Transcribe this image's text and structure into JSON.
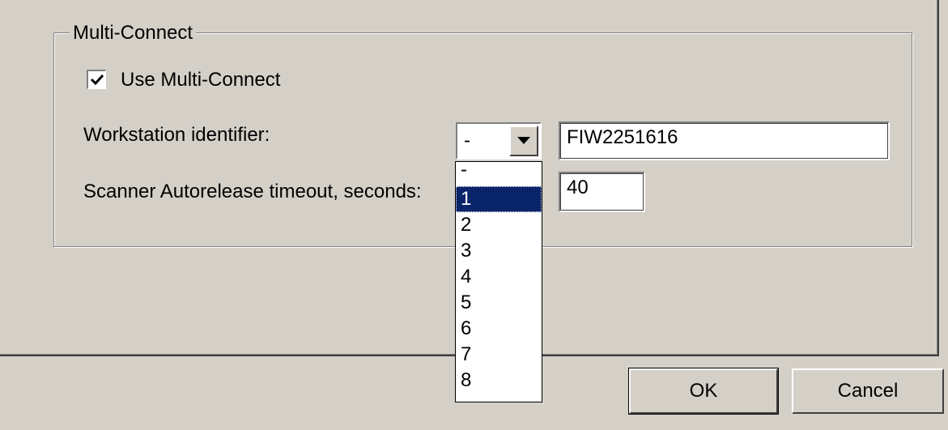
{
  "group": {
    "title": "Multi-Connect"
  },
  "use_multi_connect": {
    "label": "Use Multi-Connect",
    "checked": true
  },
  "workstation": {
    "label": "Workstation identifier:",
    "combo_value": "-",
    "dropdown_options": [
      "-",
      "1",
      "2",
      "3",
      "4",
      "5",
      "6",
      "7",
      "8"
    ],
    "highlighted_option": "1",
    "text_value": "FIW2251616"
  },
  "autorelease": {
    "label": "Scanner Autorelease timeout, seconds:",
    "value": "40"
  },
  "buttons": {
    "ok_label": "OK",
    "cancel_label": "Cancel"
  },
  "icons": {
    "checkbox": "checkmark-icon",
    "combo_button": "chevron-down-icon"
  }
}
